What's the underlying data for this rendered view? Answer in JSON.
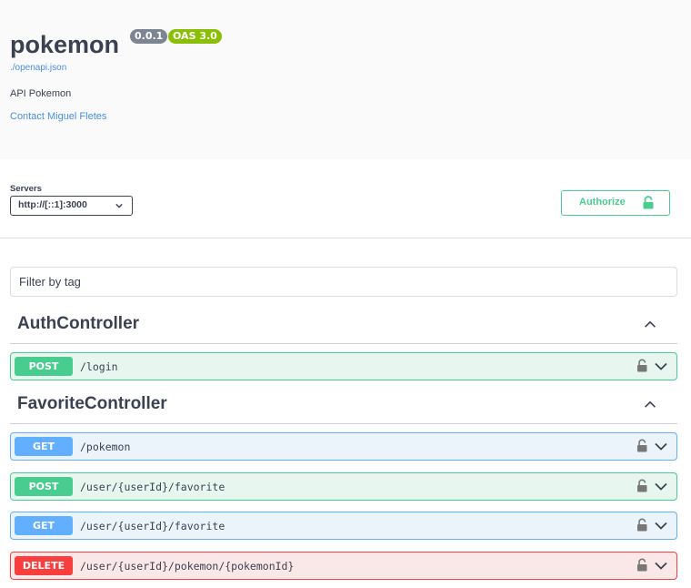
{
  "info": {
    "title": "pokemon",
    "version_badge": "0.0.1",
    "oas_badge": "OAS 3.0",
    "spec_link": "./openapi.json",
    "description": "API Pokemon",
    "contact": "Contact Miguel Fletes"
  },
  "servers": {
    "label": "Servers",
    "selected": "http://[::1]:3000"
  },
  "authorize_label": "Authorize",
  "filter_placeholder": "Filter by tag",
  "tags": [
    {
      "name": "AuthController",
      "operations": [
        {
          "method": "POST",
          "path": "/login"
        }
      ]
    },
    {
      "name": "FavoriteController",
      "operations": [
        {
          "method": "GET",
          "path": "/pokemon"
        },
        {
          "method": "POST",
          "path": "/user/{userId}/favorite"
        },
        {
          "method": "GET",
          "path": "/user/{userId}/favorite"
        },
        {
          "method": "DELETE",
          "path": "/user/{userId}/pokemon/{pokemonId}"
        }
      ]
    }
  ],
  "colors": {
    "post": "#49cc90",
    "get": "#61affe",
    "delete": "#f93e3e",
    "link": "#4990e2"
  },
  "icons": {
    "tag_toggle": "chevron-up-icon",
    "op_lock": "lock-icon",
    "op_toggle": "chevron-down-icon",
    "authorize": "lock-icon"
  }
}
